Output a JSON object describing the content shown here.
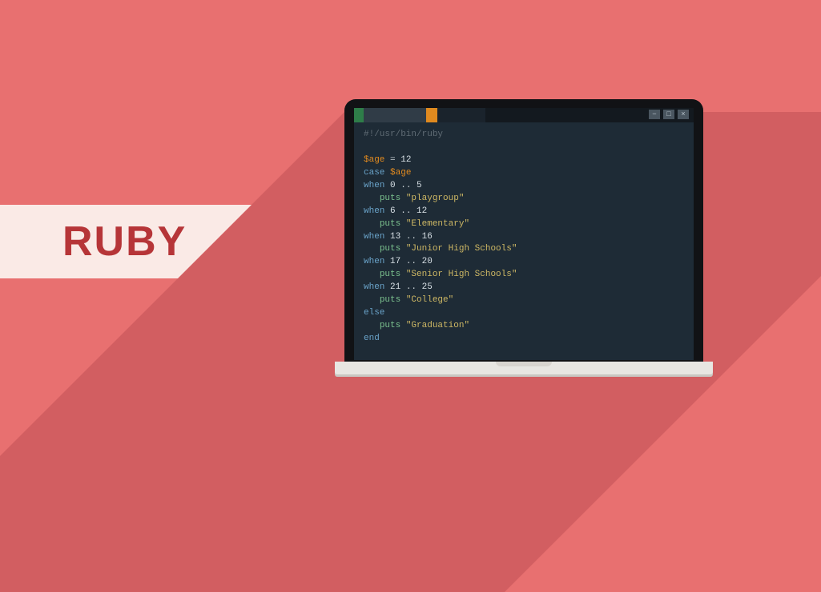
{
  "banner": {
    "title": "RUBY"
  },
  "window": {
    "buttons": {
      "min": "−",
      "max": "□",
      "close": "×"
    }
  },
  "code": {
    "shebang": "#!/usr/bin/ruby",
    "assign": {
      "var": "$age",
      "eq": " = ",
      "val": "12"
    },
    "case_kw": "case",
    "case_var": "$age",
    "when_kw": "when",
    "puts_kw": "puts",
    "else_kw": "else",
    "end_kw": "end",
    "dots": " .. ",
    "w0a": "0",
    "w0b": "5",
    "s0": "\"playgroup\"",
    "w1a": "6",
    "w1b": "12",
    "s1": "\"Elementary\"",
    "w2a": "13",
    "w2b": "16",
    "s2": "\"Junior High Schools\"",
    "w3a": "17",
    "w3b": "20",
    "s3": "\"Senior High Schools\"",
    "w4a": "21",
    "w4b": "25",
    "s4": "\"College\"",
    "s5": "\"Graduation\""
  }
}
